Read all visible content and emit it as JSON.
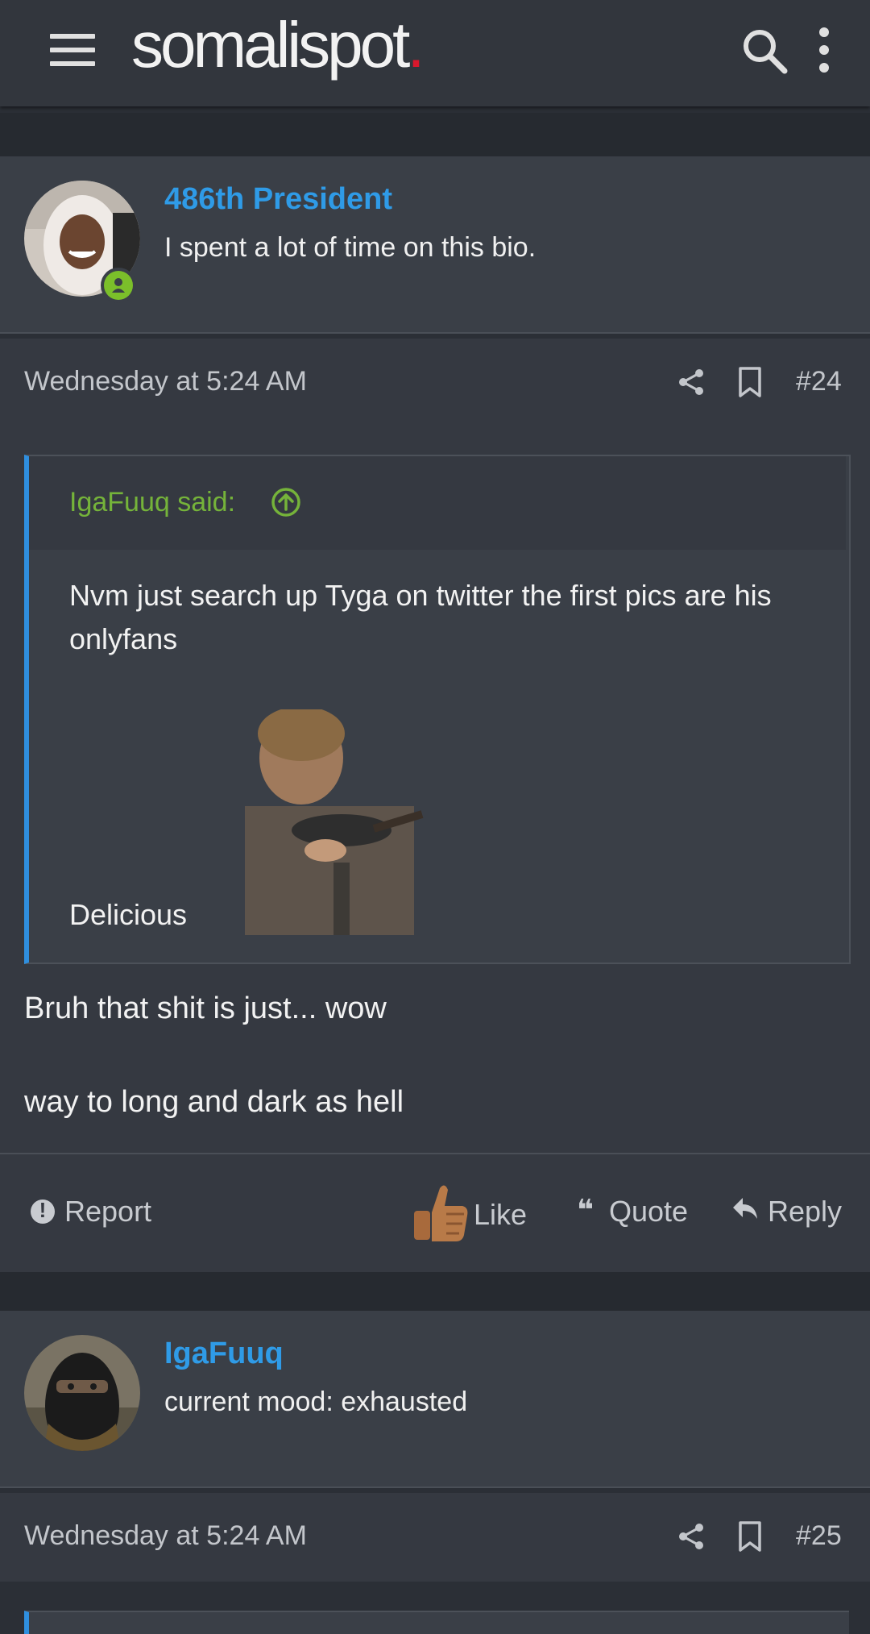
{
  "header": {
    "logo_text": "somalispot",
    "logo_dot": ".",
    "menu_icon": "hamburger-menu-icon",
    "search_icon": "search-icon",
    "more_icon": "kebab-menu-icon"
  },
  "posts": [
    {
      "username": "486th President",
      "user_title": "I spent a lot of time on this bio.",
      "online": true,
      "date": "Wednesday at 5:24 AM",
      "post_number": "#24",
      "quote": {
        "author": "IgaFuuq said:",
        "text": "Nvm just search up Tyga on twitter the first pics are his onlyfans",
        "caption": "Delicious"
      },
      "reply_lines": [
        "Bruh that shit is just... wow",
        "way to long and dark as hell"
      ],
      "actions": {
        "report": "Report",
        "like": "Like",
        "quote": "Quote",
        "reply": "Reply"
      }
    },
    {
      "username": "IgaFuuq",
      "user_title": "current mood: exhausted",
      "date": "Wednesday at 5:24 AM",
      "post_number": "#25"
    }
  ],
  "colors": {
    "username": "#2f9be7",
    "quote_author": "#75b33a",
    "quote_border": "#2f8fdf",
    "online": "#7bbf2a",
    "logo_dot": "#d9182d"
  }
}
